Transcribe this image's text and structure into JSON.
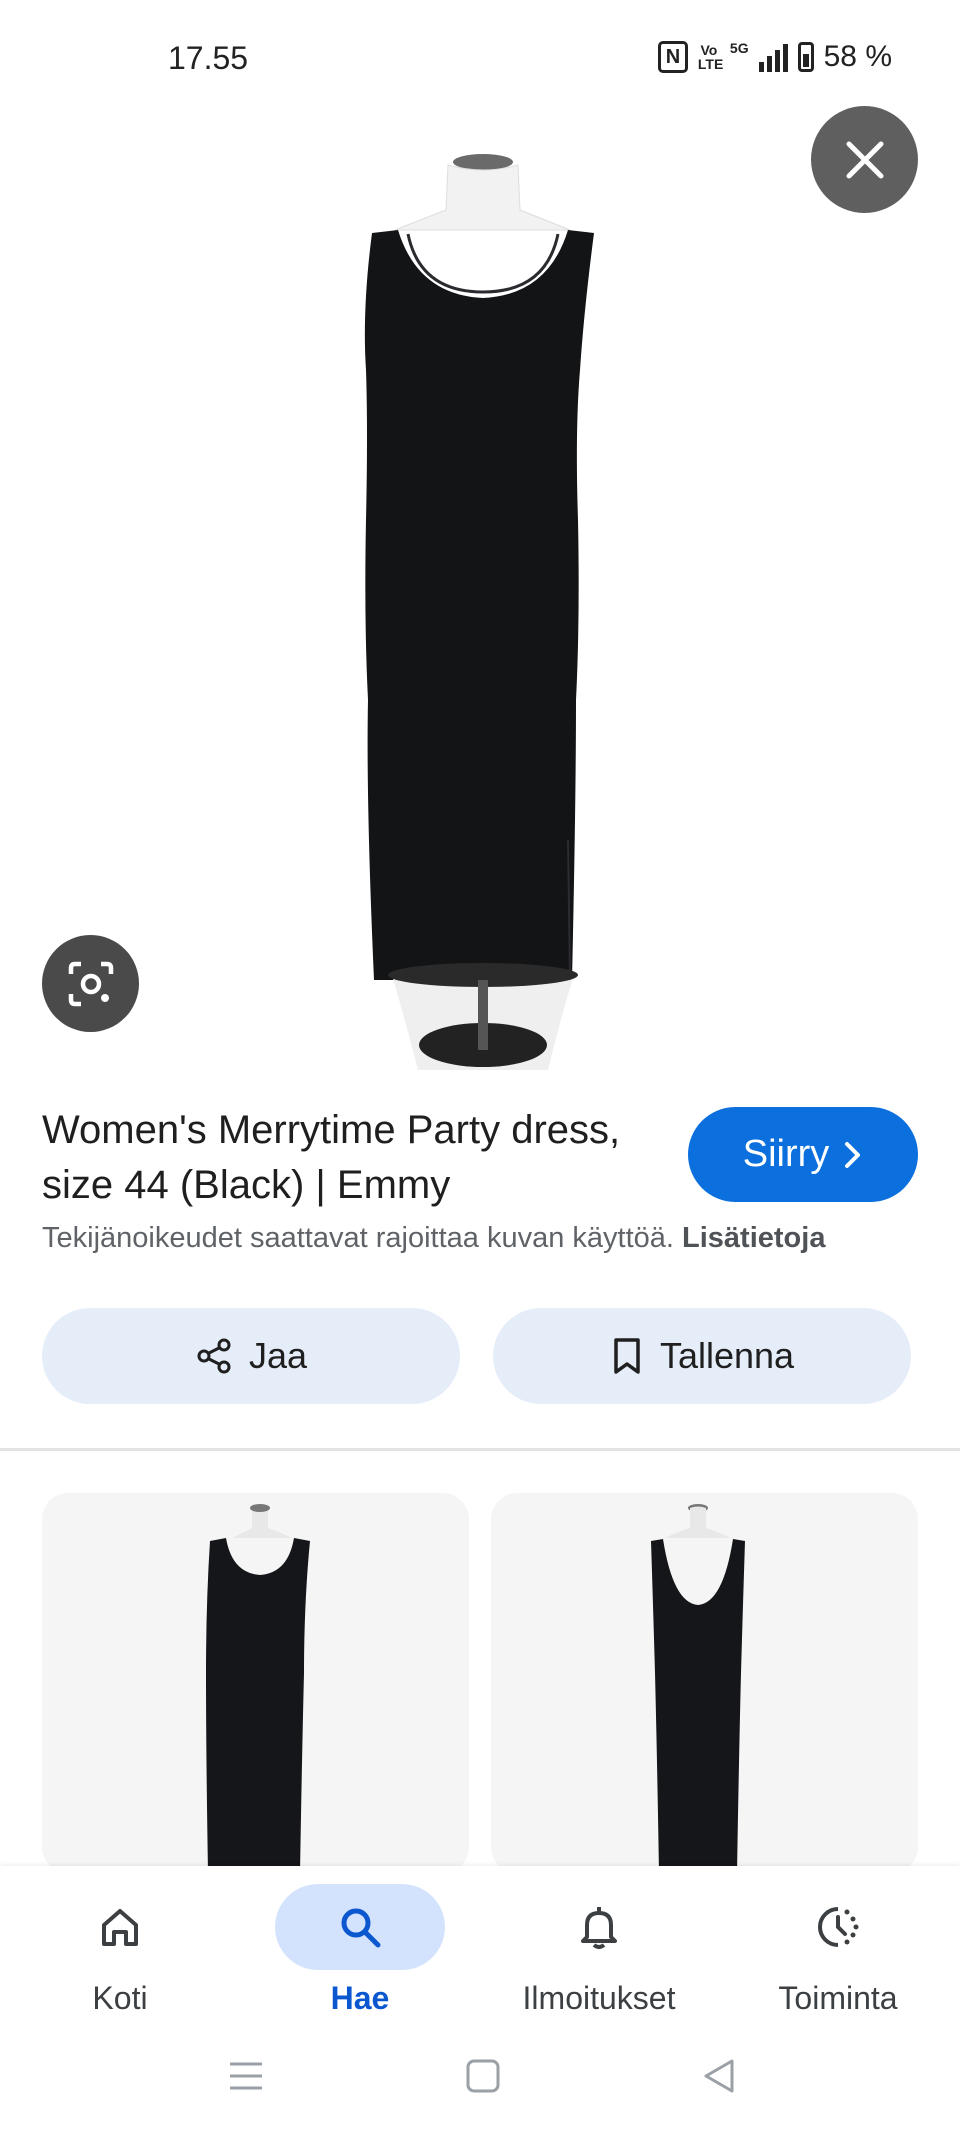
{
  "status_bar": {
    "time": "17.55",
    "volte_top": "Vo",
    "volte_bottom": "LTE",
    "network": "5G",
    "battery": "58 %"
  },
  "result": {
    "title": "Women's Merrytime Party dress, size 44 (Black) | Emmy",
    "visit_label": "Siirry",
    "copyright_text": "Tekijänoikeudet saattavat rajoittaa kuvan käyttöä.",
    "learn_more": "Lisätietoja",
    "share_label": "Jaa",
    "save_label": "Tallenna"
  },
  "nav": {
    "items": [
      {
        "label": "Koti",
        "icon": "home-icon"
      },
      {
        "label": "Hae",
        "icon": "search-icon"
      },
      {
        "label": "Ilmoitukset",
        "icon": "bell-icon"
      },
      {
        "label": "Toiminta",
        "icon": "activity-icon"
      }
    ],
    "active": "Hae"
  },
  "colors": {
    "accent": "#0b6fde",
    "pill_bg": "#e5edf9",
    "active_nav": "#0b57d0"
  }
}
